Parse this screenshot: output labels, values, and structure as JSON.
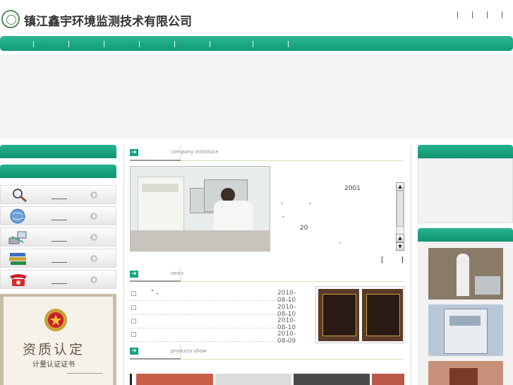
{
  "header": {
    "company_name": "镇江鑫宇环境监测技术有限公司",
    "logo_name": "company-logo"
  },
  "intro": {
    "section_title": "company introduce",
    "year_text": "2001",
    "num_text": "20",
    "comma1": ",",
    "comma2": ",",
    "comma3": ",",
    "comma4": ",",
    "more_left": "[",
    "more_right": "]"
  },
  "news": {
    "section_title": "news",
    "items": [
      {
        "title": "“   ，",
        "date": "2010-08-10"
      },
      {
        "title": "",
        "date": "2010-08-10"
      },
      {
        "title": "",
        "date": "2010-08-10"
      },
      {
        "title": "",
        "date": "2010-08-09"
      }
    ]
  },
  "products": {
    "section_title": "products show"
  },
  "left": {
    "certificate": {
      "title": "资质认定",
      "subtitle": "计量认证证书"
    }
  },
  "colors": {
    "accent_green": "#13a47f"
  }
}
